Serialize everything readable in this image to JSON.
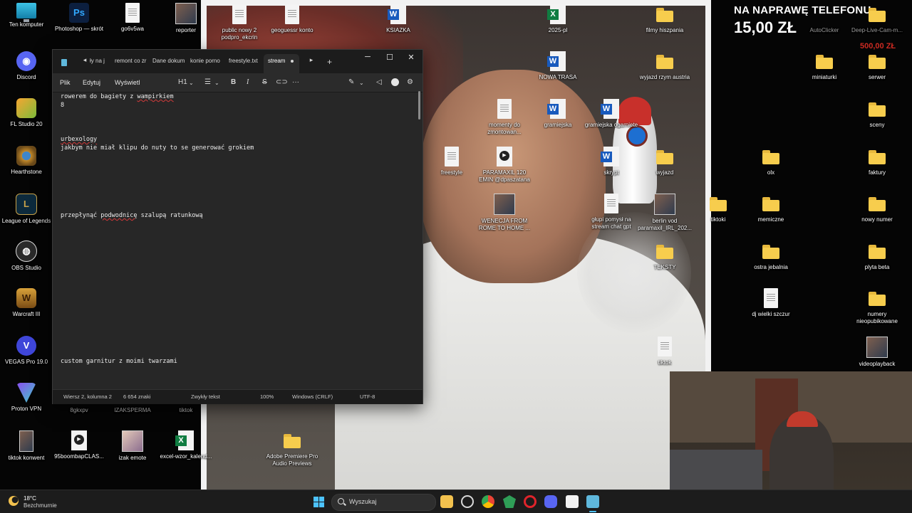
{
  "stream_overlay": {
    "goal_title": "NA NAPRAWĘ TELEFONU",
    "goal_amount": "15,00 ZŁ",
    "goal_target": "500,00 ZŁ",
    "accent_color": "#cc2a22"
  },
  "desktop": {
    "left_column": [
      {
        "label": "Ten komputer",
        "icon": "computer-icon"
      },
      {
        "label": "Discord",
        "icon": "discord-icon"
      },
      {
        "label": "FL Studio 20",
        "icon": "fl-studio-icon"
      },
      {
        "label": "Hearthstone",
        "icon": "hearthstone-icon"
      },
      {
        "label": "League of Legends",
        "icon": "league-of-legends-icon"
      },
      {
        "label": "OBS Studio",
        "icon": "obs-icon"
      },
      {
        "label": "Warcraft III",
        "icon": "warcraft-icon"
      },
      {
        "label": "VEGAS Pro 19.0",
        "icon": "vegas-icon"
      },
      {
        "label": "Proton VPN",
        "icon": "proton-vpn-icon"
      },
      {
        "label": "tiktok konwent",
        "icon": "video-file-icon"
      }
    ],
    "left_extra": [
      {
        "label": "Photoshop — skrót",
        "icon": "photoshop-icon"
      },
      {
        "label": "go6v5wa",
        "icon": "file-icon"
      },
      {
        "label": "reporter",
        "icon": "image-file-icon"
      },
      {
        "label": "8gkxpv",
        "icon": "file-icon"
      },
      {
        "label": "IZAKSPERMA",
        "icon": "file-icon"
      },
      {
        "label": "tiktok",
        "icon": "file-icon"
      },
      {
        "label": "95boombapCLAS...",
        "icon": "video-file-icon"
      },
      {
        "label": "izak emote",
        "icon": "image-file-icon"
      },
      {
        "label": "excel-wzor_kalend...",
        "icon": "excel-icon"
      },
      {
        "label": "Adobe Premiere Pro Audio Previews",
        "icon": "folder-icon"
      }
    ],
    "middle": [
      {
        "label": "public nowy 2 podpro_ekcrin",
        "icon": "text-file-icon"
      },
      {
        "label": "geoguessr konto",
        "icon": "text-file-icon"
      },
      {
        "label": "KSIAZKA",
        "icon": "word-icon"
      },
      {
        "label": "2025-pl",
        "icon": "excel-icon"
      },
      {
        "label": "filmy hiszpania",
        "icon": "folder-icon"
      },
      {
        "label": "NOWA TRASA",
        "icon": "word-icon"
      },
      {
        "label": "wyjazd rzym austria",
        "icon": "folder-icon"
      },
      {
        "label": "momenty do zmontowan...",
        "icon": "text-file-icon"
      },
      {
        "label": "gramiejska",
        "icon": "word-icon"
      },
      {
        "label": "gramiejska ogarniete",
        "icon": "word-icon"
      },
      {
        "label": "freestyle",
        "icon": "text-file-icon"
      },
      {
        "label": "PARAMAXIL 120 EMIN @dpaszatana",
        "icon": "video-file-icon"
      },
      {
        "label": "skrypt",
        "icon": "word-icon"
      },
      {
        "label": "wyjazd",
        "icon": "folder-icon"
      },
      {
        "label": "WENECJA FROM ROME TO HOME ...",
        "icon": "video-file-icon"
      },
      {
        "label": "głupi pomysł na stream chat gpt",
        "icon": "text-file-icon"
      },
      {
        "label": "berlin vod paramaxil_IRL_202...",
        "icon": "image-file-icon"
      },
      {
        "label": "TEKSTY",
        "icon": "folder-icon"
      },
      {
        "label": "tiktok",
        "icon": "text-file-icon"
      }
    ],
    "right": [
      {
        "label": "AutoClicker",
        "icon": "app-icon"
      },
      {
        "label": "Deep-Live-Cam-m...",
        "icon": "folder-icon"
      },
      {
        "label": "miniaturki",
        "icon": "folder-icon"
      },
      {
        "label": "serwer",
        "icon": "folder-icon"
      },
      {
        "label": "sceny",
        "icon": "folder-icon"
      },
      {
        "label": "olx",
        "icon": "folder-icon"
      },
      {
        "label": "faktury",
        "icon": "folder-icon"
      },
      {
        "label": "tiktoki",
        "icon": "folder-icon"
      },
      {
        "label": "memiczne",
        "icon": "folder-icon"
      },
      {
        "label": "nowy numer",
        "icon": "folder-icon"
      },
      {
        "label": "ostra jebalnia",
        "icon": "folder-icon"
      },
      {
        "label": "plyta beta",
        "icon": "folder-icon"
      },
      {
        "label": "dj wielki szczur",
        "icon": "text-file-icon"
      },
      {
        "label": "numery nieopubikowane",
        "icon": "folder-icon"
      },
      {
        "label": "videoplayback",
        "icon": "image-file-icon"
      }
    ]
  },
  "notepad": {
    "tabs": [
      "ły na j",
      "remont co zr",
      "Dane dokum",
      "konie porno",
      "freestyle.txt",
      "stream"
    ],
    "active_tab": "stream",
    "window_controls": {
      "minimize": "─",
      "maximize": "☐",
      "close": "✕"
    },
    "menu": {
      "file": "Plik",
      "edit": "Edytuj",
      "view": "Wyświetl"
    },
    "toolbar": {
      "heading": "H1",
      "bold": "B",
      "italic": "I",
      "strike": "S",
      "more": "···"
    },
    "lines": {
      "l1": [
        "rowerem do bagiety z ",
        "wampirkiem"
      ],
      "l2": "8",
      "l3": "urbexology",
      "l4": "jakbym nie miał klipu do nuty to se generować grokiem",
      "l5": [
        "przepłynąć ",
        "podwodnicę",
        " szalupą ratunkową"
      ],
      "l6": "custom garnitur z moimi twarzami"
    },
    "status": {
      "position": "Wiersz 2, kolumna 2",
      "chars": "6 654 znaki",
      "format": "Zwykły tekst",
      "zoom": "100%",
      "line_endings": "Windows (CRLF)",
      "encoding": "UTF-8"
    }
  },
  "taskbar": {
    "temperature": "18°C",
    "condition": "Bezchmurnie",
    "search_placeholder": "Wyszukaj"
  }
}
